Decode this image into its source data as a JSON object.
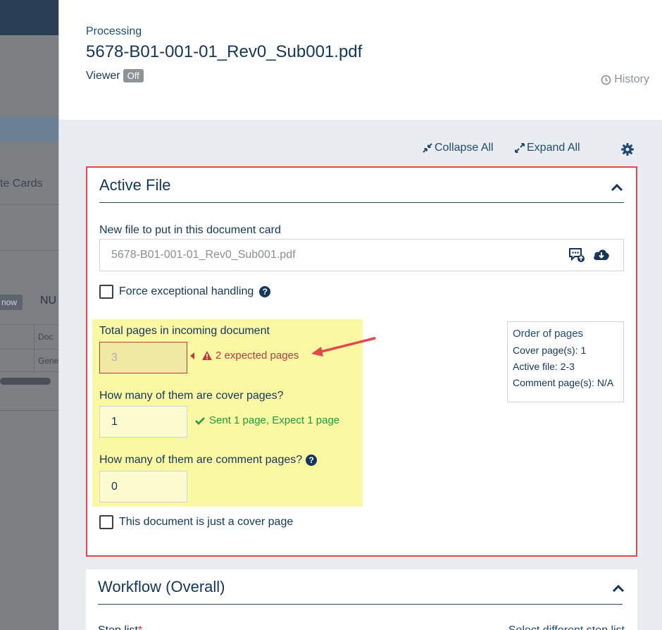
{
  "background": {
    "cards_label": "te Cards",
    "badge_label": "now",
    "col_label": "NU",
    "table": {
      "header_cell": "Doc",
      "row_cell": "Gene"
    }
  },
  "header": {
    "breadcrumb": "Processing",
    "file_name": "5678-B01-001-01_Rev0_Sub001.pdf",
    "viewer_label": "Viewer",
    "viewer_state": "Off",
    "history_label": "History"
  },
  "toolbar": {
    "collapse_all": "Collapse All",
    "expand_all": "Expand All"
  },
  "active_file": {
    "title": "Active File",
    "new_file_label": "New file to put in this document card",
    "new_file_value": "5678-B01-001-01_Rev0_Sub001.pdf",
    "force_exceptional_label": "Force exceptional handling",
    "force_exceptional_checked": false,
    "total_pages_label": "Total pages in incoming document",
    "total_pages_value": "3",
    "total_pages_error": "2 expected pages",
    "cover_pages_label": "How many of them are cover pages?",
    "cover_pages_value": "1",
    "cover_pages_ok": "Sent 1 page, Expect 1 page",
    "comment_pages_label": "How many of them are comment pages?",
    "comment_pages_value": "0",
    "just_cover_label": "This document is just a cover page",
    "just_cover_checked": false,
    "order_of_pages": {
      "title": "Order of pages",
      "cover": "Cover page(s): 1",
      "active": "Active file: 2-3",
      "comment": "Comment page(s): N/A"
    }
  },
  "workflow": {
    "title": "Workflow (Overall)",
    "sub_label": "Step list",
    "required_mark": "*",
    "right_link": "Select different step list"
  },
  "colors": {
    "accent": "#1f4b73",
    "error": "#c0393b",
    "success": "#1f9a3e",
    "highlight": "#fbf8a4",
    "annotation": "#e2494b"
  }
}
